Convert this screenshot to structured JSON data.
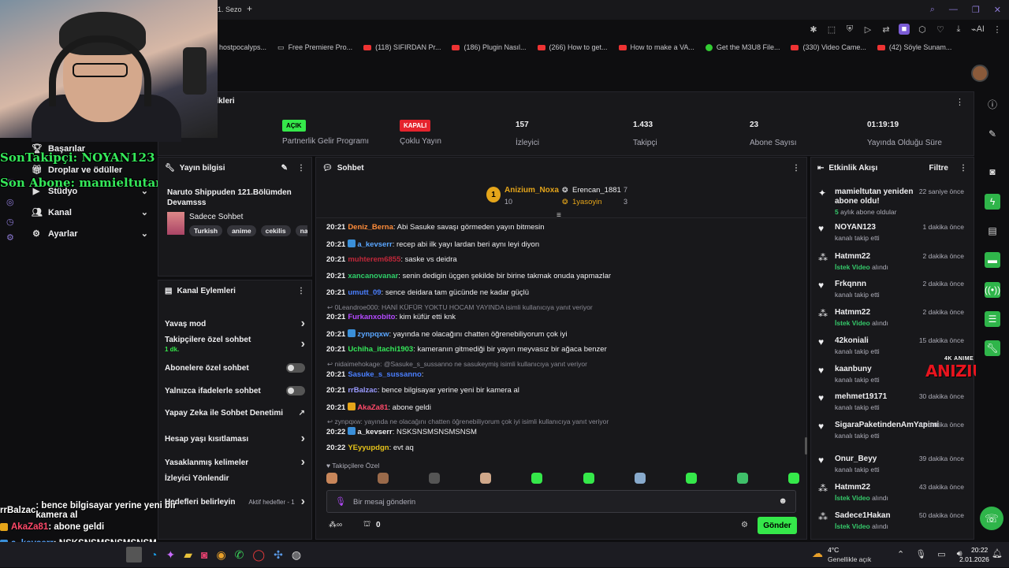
{
  "browser": {
    "tab_fragment": "1. Sezo",
    "new_tab": "+",
    "bookmarks": [
      {
        "label": "hostpocalyps...",
        "icon": "none"
      },
      {
        "label": "Free Premiere Pro...",
        "icon": "page-icon"
      },
      {
        "label": "(118) SIFIRDAN Pr...",
        "icon": "youtube-icon"
      },
      {
        "label": "(186) Plugin Nasıl...",
        "icon": "youtube-icon"
      },
      {
        "label": "(266) How to get...",
        "icon": "youtube-icon"
      },
      {
        "label": "How to make a VA...",
        "icon": "youtube-icon"
      },
      {
        "label": "Get the M3U8 File...",
        "icon": "check-icon"
      },
      {
        "label": "(330) Video Came...",
        "icon": "youtube-icon"
      },
      {
        "label": "(42) Söyle Sunam...",
        "icon": "youtube-icon"
      }
    ],
    "toolbar_ai": "AI"
  },
  "overlay": {
    "last_follower": "SonTakipçi: NOYAN123",
    "last_sub": "Son Abone: mamieltutan"
  },
  "sidebar": {
    "items": [
      {
        "label": "Başarılar",
        "icon": "trophy-icon",
        "chevron": false
      },
      {
        "label": "Droplar ve ödüller",
        "icon": "gift-icon",
        "chevron": false
      },
      {
        "label": "Stüdyo",
        "icon": "video-icon",
        "chevron": true
      },
      {
        "label": "Kanal",
        "icon": "people-icon",
        "chevron": true
      },
      {
        "label": "Ayarlar",
        "icon": "gear-icon",
        "chevron": true
      }
    ]
  },
  "stats": {
    "title": "tikleri",
    "items": [
      {
        "value": "",
        "label": "Yayın"
      },
      {
        "value": "AÇIK",
        "label": "Partnerlik Gelir Programı",
        "pill": "#35e84a"
      },
      {
        "value": "KAPALI",
        "label": "Çoklu Yayın",
        "pill": "#e5232d"
      },
      {
        "value": "157",
        "label": "İzleyici"
      },
      {
        "value": "1.433",
        "label": "Takipçi"
      },
      {
        "value": "23",
        "label": "Abone Sayısı"
      },
      {
        "value": "01:19:19",
        "label": "Yayında Olduğu Süre"
      }
    ]
  },
  "stream_info": {
    "header": "Yayın bilgisi",
    "title": "Naruto Shippuden 121.Bölümden Devamsss",
    "category": "Sadece Sohbet",
    "tags": [
      "Turkish",
      "anime",
      "cekilis",
      "naru"
    ]
  },
  "channel_actions": {
    "header": "Kanal Eylemleri",
    "items": [
      {
        "label": "Yavaş mod",
        "type": "chevron"
      },
      {
        "label": "Takipçilere özel sohbet",
        "sub": "1 dk.",
        "type": "chevron"
      },
      {
        "label": "Abonelere özel sohbet",
        "type": "toggle"
      },
      {
        "label": "Yalnızca ifadelerle sohbet",
        "type": "toggle"
      },
      {
        "label": "Yapay Zeka ile Sohbet Denetimi",
        "type": "external"
      },
      {
        "label": "Hesap yaşı kısıtlaması",
        "type": "chevron"
      },
      {
        "label": "Yasaklanmış kelimeler",
        "type": "chevron"
      },
      {
        "label": "İzleyici Yönlendir",
        "type": "none"
      },
      {
        "label": "Hedefleri belirleyin",
        "extra": "Aktif hedefler - 1",
        "type": "chevron"
      }
    ]
  },
  "chat": {
    "header": "Sohbet",
    "leaderboard": [
      {
        "rank": "1",
        "name": "Anizium_Noxa",
        "score": "10"
      },
      {
        "name": "Erencan_1881",
        "score": "7"
      },
      {
        "name": "1yasoyin",
        "score": "3"
      }
    ],
    "messages": [
      {
        "time": "20:21",
        "user": "Deniz_Berna",
        "color": "#ff8c3a",
        "text": ": Abi Sasuke savaşı görmeden yayın bitmesin"
      },
      {
        "time": "20:21",
        "user": "a_kevserr",
        "color": "#5aa6ff",
        "badge": "blue",
        "text": ": recep abi ilk yayı lardan beri aynı leyi diyon"
      },
      {
        "time": "20:21",
        "user": "muhterem6855",
        "color": "#c0283a",
        "text": ": saske vs deidra"
      },
      {
        "time": "20:21",
        "user": "xancanovanar",
        "color": "#2fd06a",
        "text": ": senin dedigin üçgen şekilde bir birine takmak onuda yapmazlar"
      },
      {
        "time": "20:21",
        "user": "umutt_09",
        "color": "#4a7fff",
        "text": ": sence deidara tam gücünde ne kadar güçlü"
      },
      {
        "reply": "0Leandroe000: HANİ KÜFÜR YOKTU HOCAM YAYINDA isimli kullanıcıya yanıt veriyor"
      },
      {
        "time": "20:21",
        "user": "Furkanxobito",
        "color": "#b44aff",
        "text": ": kim küfür etti knk"
      },
      {
        "time": "20:21",
        "user": "zynpqxw",
        "color": "#5aa6ff",
        "badge": "blue",
        "text": ": yayında ne olacağını chatten öğrenebiliyorum çok iyi"
      },
      {
        "time": "20:21",
        "user": "Uchiha_itachi1903",
        "color": "#35e85a",
        "text": ": kameranın gitmediği bir yayın meyvasız bir ağaca benzer"
      },
      {
        "reply": "nidaimehokage: @Sasuke_s_sussanno ne sasukeymiş isimli kullanıcıya yanıt veriyor"
      },
      {
        "time": "20:21",
        "user": "Sasuke_s_sussanno",
        "color": "#4a7fff",
        "text": ": "
      },
      {
        "time": "20:21",
        "user": "rrBalzac",
        "color": "#9a9aff",
        "text": ": bence bilgisayar yerine yeni bir kamera al"
      },
      {
        "time": "20:21",
        "user": "AkaZa81",
        "color": "#ff4a6a",
        "badge": "gold",
        "text": ": abone geldi"
      },
      {
        "reply": "zynpqxw: yayında ne olacağını chatten öğrenebiliyorum çok iyi isimli kullanıcıya yanıt veriyor"
      },
      {
        "time": "20:22",
        "user": "a_kevserr",
        "color": "#efeff1",
        "badge": "blue",
        "text": ": NSKSNSMSNSMSNSM"
      },
      {
        "time": "20:22",
        "user": "YEyyupdgn",
        "color": "#e5c21a",
        "text": ": evt aq"
      }
    ],
    "followers_only_label": "Takipçilere Özel",
    "input_placeholder": "Bir mesaj gönderin",
    "points": "0",
    "send_label": "Gönder"
  },
  "activity": {
    "header": "Etkinlik Akışı",
    "filter_label": "Filtre",
    "events": [
      {
        "icon": "sparkle-icon",
        "name": "mamieltutan yeniden abone oldu!",
        "sub_b": "5",
        "sub": " aylık abone oldular",
        "time": "22 saniye önce"
      },
      {
        "icon": "heart-icon",
        "name": "NOYAN123",
        "sub": "kanalı takip etti",
        "time": "1 dakika önce"
      },
      {
        "icon": "bits-icon",
        "name": "Hatmm22",
        "sub_b": "İstek Video",
        "sub": " alındı",
        "time": "2 dakika önce"
      },
      {
        "icon": "heart-icon",
        "name": "Frkqnnn",
        "sub": "kanalı takip etti",
        "time": "2 dakika önce"
      },
      {
        "icon": "bits-icon",
        "name": "Hatmm22",
        "sub_b": "İstek Video",
        "sub": " alındı",
        "time": "2 dakika önce"
      },
      {
        "icon": "heart-icon",
        "name": "42koniali",
        "sub": "kanalı takip etti",
        "time": "15 dakika önce"
      },
      {
        "icon": "heart-icon",
        "name": "kaanbuny",
        "sub": "kanalı takip etti",
        "time": "3"
      },
      {
        "icon": "heart-icon",
        "name": "mehmet19171",
        "sub": "kanalı takip etti",
        "time": "30 dakika önce"
      },
      {
        "icon": "heart-icon",
        "name": "SigaraPaketindenAmYapimi",
        "sub": "kanalı takip etti",
        "time": "32 dakika önce"
      },
      {
        "icon": "heart-icon",
        "name": "Onur_Beyy",
        "sub": "kanalı takip etti",
        "time": "39 dakika önce"
      },
      {
        "icon": "bits-icon",
        "name": "Hatmm22",
        "sub_b": "İstek Video",
        "sub": " alındı",
        "time": "43 dakika önce"
      },
      {
        "icon": "bits-icon",
        "name": "Sadece1Hakan",
        "sub_b": "İstek Video",
        "sub": " alındı",
        "time": "50 dakika önce"
      }
    ]
  },
  "logo": {
    "small": "4K ANIME MOVIE",
    "big": "ANIZIUM"
  },
  "bottom_chat": [
    {
      "user": "rrBalzac",
      "text": " : bence bilgisayar yerine yeni bir kamera al",
      "color": "#ffffff"
    },
    {
      "user": "AkaZa81",
      "text": " : abone geldi",
      "color": "#ff4a6a"
    },
    {
      "user": "a_kevserr",
      "text": " : NSKSNSMSNSMSNSM",
      "color": "#5aa6ff"
    },
    {
      "user": "YEyyupdgn",
      "text": " : evt aq",
      "color": "#e5c21a"
    }
  ],
  "taskbar": {
    "weather_temp": "4°C",
    "weather_desc": "Genellikle açık",
    "time": "20:22",
    "date": "2.01.2026"
  }
}
